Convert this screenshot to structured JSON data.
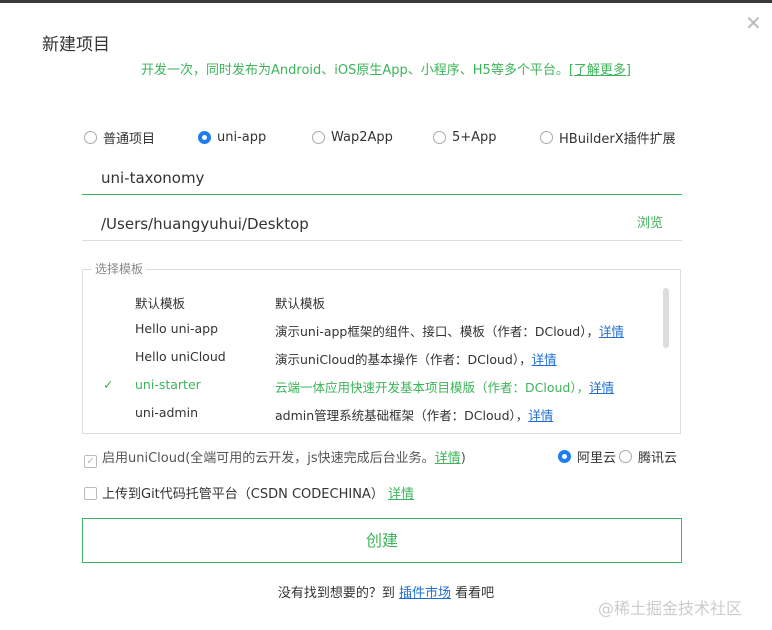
{
  "dialog": {
    "title": "新建项目",
    "subtitle": "开发一次，同时发布为Android、iOS原生App、小程序、H5等多个平台。",
    "learn_more": "[了解更多]"
  },
  "project_types": [
    {
      "label": "普通项目",
      "selected": false
    },
    {
      "label": "uni-app",
      "selected": true
    },
    {
      "label": "Wap2App",
      "selected": false
    },
    {
      "label": "5+App",
      "selected": false
    },
    {
      "label": "HBuilderX插件扩展",
      "selected": false
    }
  ],
  "project_name": "uni-taxonomy",
  "project_path": "/Users/huangyuhui/Desktop",
  "browse_label": "浏览",
  "templates": {
    "label": "选择模板",
    "items": [
      {
        "name": "默认模板",
        "desc": "默认模板",
        "link": "",
        "selected": false
      },
      {
        "name": "Hello uni-app",
        "desc": "演示uni-app框架的组件、接口、模板（作者：DCloud），",
        "link": "详情",
        "selected": false
      },
      {
        "name": "Hello uniCloud",
        "desc": "演示uniCloud的基本操作（作者：DCloud），",
        "link": "详情",
        "selected": false
      },
      {
        "name": "uni-starter",
        "desc": "云端一体应用快速开发基本项目模版（作者：DCloud），",
        "link": "详情",
        "selected": true
      },
      {
        "name": "uni-admin",
        "desc": "admin管理系统基础框架（作者：DCloud），",
        "link": "详情",
        "selected": false
      }
    ]
  },
  "unicloud": {
    "label": "启用uniCloud(全端可用的云开发，js快速完成后台业务。",
    "link": "详情",
    "suffix": ")",
    "checked": true,
    "providers": [
      {
        "label": "阿里云",
        "selected": true
      },
      {
        "label": "腾讯云",
        "selected": false
      }
    ]
  },
  "git": {
    "label": "上传到Git代码托管平台（CSDN CODECHINA）",
    "link": "详情",
    "checked": false
  },
  "create_label": "创建",
  "footer": {
    "prefix": "没有找到想要的？到 ",
    "link": "插件市场",
    "suffix": " 看看吧"
  },
  "watermark": "@稀土掘金技术社区"
}
